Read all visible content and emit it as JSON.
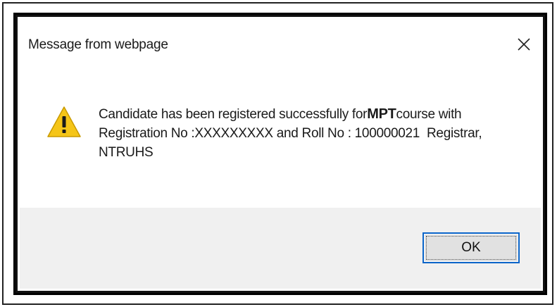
{
  "dialog": {
    "title": "Message from webpage",
    "close_icon": "close-icon",
    "warning_icon": "warning-icon",
    "message": {
      "line1_prefix": "Candidate has been registered successfully for",
      "course": "MPT",
      "line1_suffix": "course with",
      "line2": "Registration No :XXXXXXXXX and Roll No : 100000021  Registrar,",
      "line3": "NTRUHS"
    },
    "ok_label": "OK"
  },
  "colors": {
    "footer_bg": "#f0f0f0",
    "button_focus_border": "#0a64c8",
    "warning_fill": "#f5c518"
  }
}
